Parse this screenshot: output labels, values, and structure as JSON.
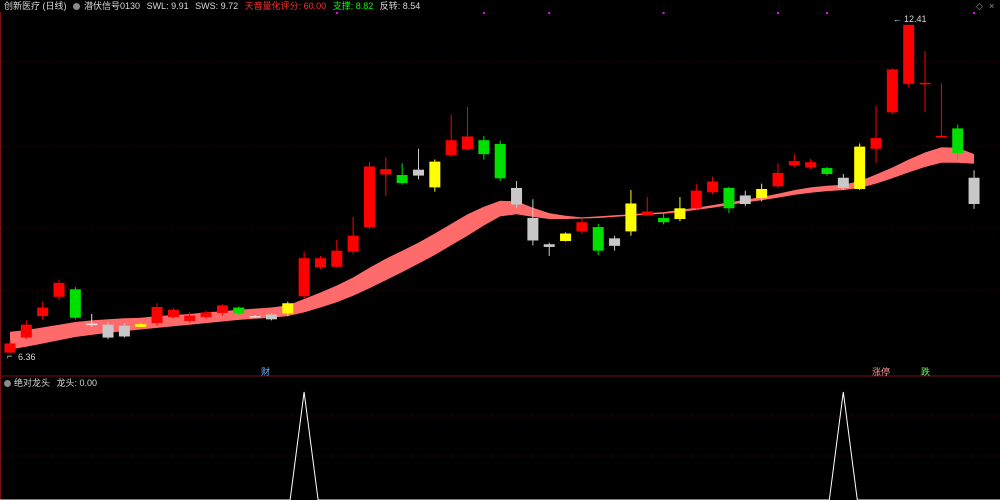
{
  "header": {
    "stock_name": "创新医疗 (日线)",
    "indicator_name": "潜伏信号0130",
    "swl": "SWL: 9.91",
    "sws": "SWS: 9.72",
    "ai_score": "天音量化评分: 60.00",
    "support": "支撑: 8.82",
    "resistance": "反转: 8.54",
    "corner_left": "◇",
    "corner_right": "×"
  },
  "sub_header": {
    "indicator_name": "绝对龙头",
    "value_label": "龙头: 0.00"
  },
  "colors": {
    "up": "#ff0000",
    "down": "#00e000",
    "yellow": "#ffff00",
    "gray": "#c8c8c8",
    "band": "#ff6b6b",
    "text": "#d8d8d8",
    "red_text": "#ff3030",
    "green_text": "#00ff00",
    "grid": "#3a0000",
    "magenta": "#ff00ff"
  },
  "chart_data": [
    {
      "type": "candlestick",
      "price_range": [
        6.05,
        12.65
      ],
      "annotations": {
        "high_label": "12.41",
        "low_label": "6.36",
        "event_cai": "财",
        "event_zhangting": "涨停",
        "event_die": "跌"
      },
      "candles": [
        {
          "o": 6.3,
          "c": 6.47,
          "h": 6.52,
          "l": 6.28,
          "col": "red"
        },
        {
          "o": 6.58,
          "c": 6.82,
          "h": 6.9,
          "l": 6.55,
          "col": "red"
        },
        {
          "o": 6.98,
          "c": 7.14,
          "h": 7.25,
          "l": 6.92,
          "col": "red"
        },
        {
          "o": 7.34,
          "c": 7.6,
          "h": 7.66,
          "l": 7.28,
          "col": "red"
        },
        {
          "o": 7.48,
          "c": 6.95,
          "h": 7.52,
          "l": 6.92,
          "col": "green"
        },
        {
          "o": 6.84,
          "c": 6.84,
          "h": 7.02,
          "l": 6.78,
          "col": "white"
        },
        {
          "o": 6.82,
          "c": 6.58,
          "h": 6.87,
          "l": 6.55,
          "col": "gray"
        },
        {
          "o": 6.8,
          "c": 6.6,
          "h": 6.85,
          "l": 6.58,
          "col": "gray"
        },
        {
          "o": 6.78,
          "c": 6.83,
          "h": 6.86,
          "l": 6.78,
          "col": "yellow"
        },
        {
          "o": 6.85,
          "c": 7.15,
          "h": 7.22,
          "l": 6.8,
          "col": "red"
        },
        {
          "o": 6.96,
          "c": 7.1,
          "h": 7.13,
          "l": 6.93,
          "col": "red"
        },
        {
          "o": 6.89,
          "c": 6.99,
          "h": 7.05,
          "l": 6.86,
          "col": "red"
        },
        {
          "o": 6.96,
          "c": 7.05,
          "h": 7.08,
          "l": 6.93,
          "col": "red"
        },
        {
          "o": 7.04,
          "c": 7.18,
          "h": 7.2,
          "l": 6.99,
          "col": "red"
        },
        {
          "o": 7.14,
          "c": 7.03,
          "h": 7.16,
          "l": 7.0,
          "col": "green"
        },
        {
          "o": 6.98,
          "c": 6.96,
          "h": 7.0,
          "l": 6.95,
          "col": "white"
        },
        {
          "o": 7.01,
          "c": 6.92,
          "h": 7.04,
          "l": 6.9,
          "col": "gray"
        },
        {
          "o": 7.03,
          "c": 7.22,
          "h": 7.25,
          "l": 6.98,
          "col": "yellow"
        },
        {
          "o": 7.35,
          "c": 8.06,
          "h": 8.18,
          "l": 7.3,
          "col": "red"
        },
        {
          "o": 7.89,
          "c": 8.06,
          "h": 8.1,
          "l": 7.85,
          "col": "red"
        },
        {
          "o": 7.9,
          "c": 8.2,
          "h": 8.4,
          "l": 7.88,
          "col": "red"
        },
        {
          "o": 8.18,
          "c": 8.48,
          "h": 8.83,
          "l": 8.13,
          "col": "red"
        },
        {
          "o": 8.64,
          "c": 9.77,
          "h": 9.85,
          "l": 8.6,
          "col": "red"
        },
        {
          "o": 9.62,
          "c": 9.72,
          "h": 9.94,
          "l": 9.22,
          "col": "red"
        },
        {
          "o": 9.61,
          "c": 9.46,
          "h": 9.83,
          "l": 9.43,
          "col": "green"
        },
        {
          "o": 9.6,
          "c": 9.71,
          "h": 10.1,
          "l": 9.53,
          "col": "gray"
        },
        {
          "o": 9.38,
          "c": 9.86,
          "h": 9.9,
          "l": 9.3,
          "col": "yellow"
        },
        {
          "o": 9.98,
          "c": 10.26,
          "h": 10.73,
          "l": 9.95,
          "col": "red"
        },
        {
          "o": 10.09,
          "c": 10.33,
          "h": 10.88,
          "l": 10.07,
          "col": "red"
        },
        {
          "o": 10.26,
          "c": 10.0,
          "h": 10.34,
          "l": 9.9,
          "col": "green"
        },
        {
          "o": 10.19,
          "c": 9.55,
          "h": 10.25,
          "l": 9.5,
          "col": "green"
        },
        {
          "o": 9.37,
          "c": 9.06,
          "h": 9.5,
          "l": 9.0,
          "col": "gray"
        },
        {
          "o": 8.81,
          "c": 8.39,
          "h": 9.16,
          "l": 8.3,
          "col": "gray"
        },
        {
          "o": 8.32,
          "c": 8.27,
          "h": 8.35,
          "l": 8.1,
          "col": "gray"
        },
        {
          "o": 8.38,
          "c": 8.52,
          "h": 8.54,
          "l": 8.37,
          "col": "yellow"
        },
        {
          "o": 8.56,
          "c": 8.73,
          "h": 8.8,
          "l": 8.51,
          "col": "red"
        },
        {
          "o": 8.64,
          "c": 8.2,
          "h": 8.7,
          "l": 8.12,
          "col": "green"
        },
        {
          "o": 8.29,
          "c": 8.43,
          "h": 8.48,
          "l": 8.2,
          "col": "gray"
        },
        {
          "o": 8.56,
          "c": 9.08,
          "h": 9.33,
          "l": 8.48,
          "col": "yellow"
        },
        {
          "o": 8.86,
          "c": 8.93,
          "h": 9.2,
          "l": 8.85,
          "col": "red"
        },
        {
          "o": 8.81,
          "c": 8.73,
          "h": 8.9,
          "l": 8.69,
          "col": "green"
        },
        {
          "o": 8.79,
          "c": 8.99,
          "h": 9.2,
          "l": 8.75,
          "col": "yellow"
        },
        {
          "o": 8.99,
          "c": 9.32,
          "h": 9.45,
          "l": 8.95,
          "col": "red"
        },
        {
          "o": 9.29,
          "c": 9.49,
          "h": 9.58,
          "l": 9.25,
          "col": "red"
        },
        {
          "o": 9.37,
          "c": 8.99,
          "h": 9.39,
          "l": 8.9,
          "col": "green"
        },
        {
          "o": 9.07,
          "c": 9.23,
          "h": 9.32,
          "l": 9.03,
          "col": "gray"
        },
        {
          "o": 9.18,
          "c": 9.35,
          "h": 9.45,
          "l": 9.12,
          "col": "yellow"
        },
        {
          "o": 9.4,
          "c": 9.65,
          "h": 9.83,
          "l": 9.37,
          "col": "red"
        },
        {
          "o": 9.79,
          "c": 9.87,
          "h": 10.0,
          "l": 9.75,
          "col": "red"
        },
        {
          "o": 9.75,
          "c": 9.85,
          "h": 9.91,
          "l": 9.72,
          "col": "red"
        },
        {
          "o": 9.74,
          "c": 9.63,
          "h": 9.76,
          "l": 9.6,
          "col": "green"
        },
        {
          "o": 9.37,
          "c": 9.56,
          "h": 9.63,
          "l": 9.33,
          "col": "gray"
        },
        {
          "o": 9.35,
          "c": 10.14,
          "h": 10.2,
          "l": 9.33,
          "col": "yellow"
        },
        {
          "o": 10.1,
          "c": 10.3,
          "h": 10.9,
          "l": 9.84,
          "col": "red"
        },
        {
          "o": 10.78,
          "c": 11.58,
          "h": 11.6,
          "l": 10.75,
          "col": "red"
        },
        {
          "o": 11.31,
          "c": 12.41,
          "h": 12.41,
          "l": 11.25,
          "col": "red"
        },
        {
          "o": 11.33,
          "c": 11.33,
          "h": 11.92,
          "l": 10.78,
          "col": "red"
        },
        {
          "o": 10.34,
          "c": 10.34,
          "h": 11.32,
          "l": 10.33,
          "col": "red"
        },
        {
          "o": 10.02,
          "c": 10.48,
          "h": 10.55,
          "l": 9.9,
          "col": "green"
        },
        {
          "o": 9.56,
          "c": 9.07,
          "h": 9.7,
          "l": 8.98,
          "col": "gray"
        }
      ],
      "band_upper": [
        6.69,
        6.72,
        6.77,
        6.82,
        6.87,
        6.9,
        6.92,
        6.94,
        6.95,
        6.98,
        7.0,
        7.02,
        7.05,
        7.07,
        7.1,
        7.12,
        7.14,
        7.18,
        7.3,
        7.42,
        7.55,
        7.7,
        7.88,
        8.05,
        8.2,
        8.35,
        8.52,
        8.7,
        8.88,
        9.02,
        9.13,
        9.12,
        9.0,
        8.9,
        8.85,
        8.82,
        8.84,
        8.86,
        8.88,
        8.9,
        8.92,
        8.96,
        9.0,
        9.05,
        9.1,
        9.15,
        9.2,
        9.26,
        9.33,
        9.38,
        9.41,
        9.43,
        9.5,
        9.62,
        9.75,
        9.9,
        10.03,
        10.13,
        10.12,
        10.0
      ],
      "band_lower": [
        6.36,
        6.41,
        6.47,
        6.53,
        6.59,
        6.63,
        6.67,
        6.7,
        6.73,
        6.76,
        6.79,
        6.82,
        6.85,
        6.88,
        6.91,
        6.93,
        6.95,
        6.98,
        7.05,
        7.14,
        7.24,
        7.36,
        7.5,
        7.65,
        7.8,
        7.96,
        8.12,
        8.3,
        8.48,
        8.67,
        8.84,
        8.88,
        8.83,
        8.79,
        8.79,
        8.8,
        8.81,
        8.83,
        8.85,
        8.87,
        8.89,
        8.92,
        8.96,
        9.0,
        9.05,
        9.1,
        9.14,
        9.19,
        9.24,
        9.28,
        9.31,
        9.33,
        9.37,
        9.45,
        9.55,
        9.66,
        9.76,
        9.84,
        9.84,
        9.82
      ],
      "top_markers": [
        20,
        29,
        33,
        40,
        47,
        50,
        59
      ]
    },
    {
      "type": "line",
      "name": "龙头",
      "current_value": 0.0,
      "peaks_at_candle": [
        18,
        51
      ]
    }
  ]
}
